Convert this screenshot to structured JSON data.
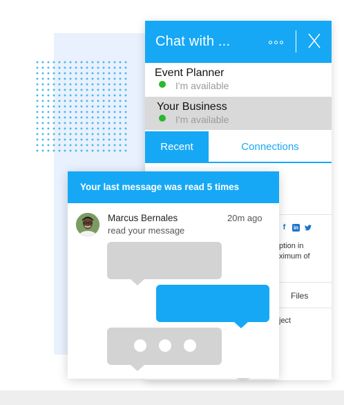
{
  "chat_widget": {
    "title": "Chat with ...",
    "contacts": [
      {
        "name": "Event Planner",
        "status": "I'm available",
        "selected": false
      },
      {
        "name": "Your Business",
        "status": "I'm available",
        "selected": true
      }
    ],
    "tabs": [
      {
        "label": "Recent",
        "active": true
      },
      {
        "label": "Connections",
        "active": false
      }
    ],
    "partial_text": {
      "line1": "ption in",
      "line2": "ximum of",
      "files": "Files",
      "line3": "ject"
    }
  },
  "message_card": {
    "header": "Your last message was read 5 times",
    "sender": "Marcus Bernales",
    "time": "20m ago",
    "preview": "read your message"
  },
  "colors": {
    "accent": "#16a8f5",
    "status_green": "#29b830",
    "bubble_gray": "#d3d3d3",
    "background_panel": "#e8f1fd"
  },
  "icons": [
    "more-options-icon",
    "close-icon",
    "status-available-icon",
    "facebook-icon",
    "linkedin-icon",
    "twitter-icon"
  ]
}
